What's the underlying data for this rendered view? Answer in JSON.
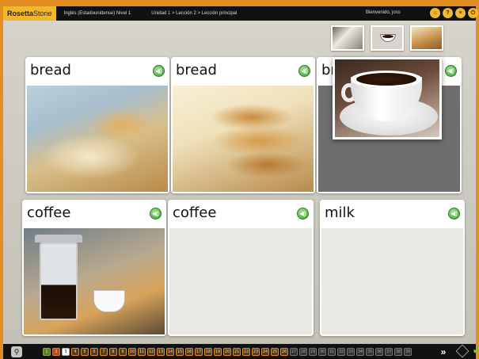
{
  "topbar": {
    "brand_bold": "Rosetta",
    "brand_rest": "Stone",
    "course": "Inglés (Estadounidense) Nivel 1",
    "breadcrumb": "Unidad 1 > Lección 2 > Lección principal",
    "welcome": "Bienvenido, joss",
    "icons": [
      "home-icon",
      "help-icon",
      "menu-icon",
      "exit-icon"
    ],
    "icon_glyphs": [
      "⌂",
      "?",
      "≡",
      "⏻"
    ]
  },
  "thumbnails": [
    "milk",
    "coffee",
    "bread"
  ],
  "cards": [
    {
      "label": "bread",
      "image": "sliced-bread",
      "state": "image"
    },
    {
      "label": "bread",
      "image": "braided-bread",
      "state": "image"
    },
    {
      "label": "br",
      "image": "",
      "state": "covered"
    },
    {
      "label": "coffee",
      "image": "french-press",
      "state": "image"
    },
    {
      "label": "coffee",
      "image": "",
      "state": "empty"
    },
    {
      "label": "milk",
      "image": "",
      "state": "empty"
    }
  ],
  "speaker_glyph": "◀)",
  "overlay_image": "coffee-cup",
  "bottombar": {
    "search_glyph": "⚲",
    "pages": [
      "1",
      "2",
      "3",
      "4",
      "5",
      "6",
      "7",
      "8",
      "9",
      "10",
      "11",
      "12",
      "13",
      "14",
      "15",
      "16",
      "17",
      "18",
      "19",
      "20",
      "21",
      "22",
      "23",
      "24",
      "25",
      "26",
      "27",
      "28",
      "29",
      "30",
      "31",
      "32",
      "33",
      "34",
      "35",
      "36",
      "37",
      "38",
      "39"
    ],
    "current_page": "3",
    "next_glyph": "»",
    "check_glyph": "✔"
  },
  "colors": {
    "frame_orange": "#e38d22",
    "brand_yellow": "#f2b731",
    "speaker_green": "#3d9a32"
  }
}
